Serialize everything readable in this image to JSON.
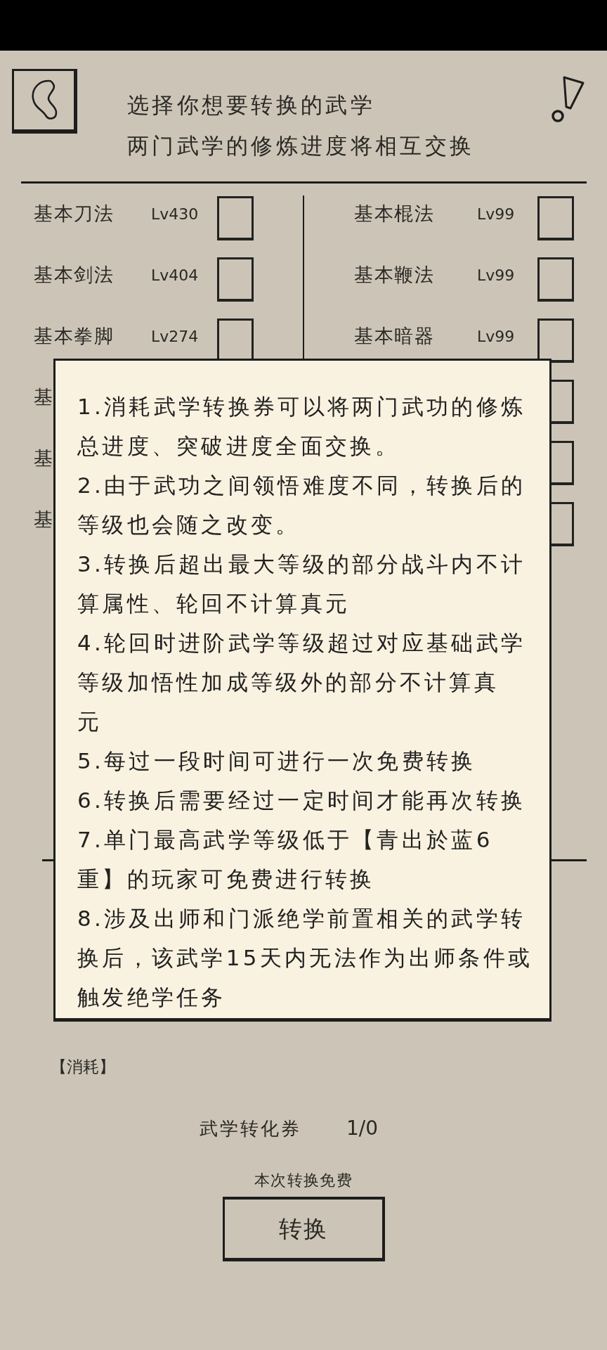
{
  "header": {
    "lines": [
      "选择你想要转换的武学",
      "两门武学的修炼进度将相互交换"
    ]
  },
  "skills": {
    "left": [
      {
        "name": "基本刀法",
        "grade": "Lv430",
        "checked": false
      },
      {
        "name": "基本剑法",
        "grade": "Lv404",
        "checked": false
      },
      {
        "name": "基本拳脚",
        "grade": "Lv274",
        "checked": false
      },
      {
        "name": "基"
      },
      {
        "name": "基"
      },
      {
        "name": "基"
      }
    ],
    "right": [
      {
        "name": "基本棍法",
        "grade": "Lv99",
        "checked": false
      },
      {
        "name": "基本鞭法",
        "grade": "Lv99",
        "checked": false
      },
      {
        "name": "基本暗器",
        "grade": "Lv99",
        "checked": false
      },
      {
        "checked": false
      },
      {
        "checked": false
      },
      {
        "checked": false
      }
    ]
  },
  "info_popup": {
    "notes": [
      {
        "lines": [
          "1.消耗武学转换券可以将两门武功的修炼",
          "总进度、突破进度全面交换。"
        ]
      },
      {
        "lines": [
          "2.由于武功之间领悟难度不同，转换后的",
          "等级也会随之改变。"
        ]
      },
      {
        "lines": [
          "3.转换后超出最大等级的部分战斗内不计",
          "算属性、轮回不计算真元"
        ]
      },
      {
        "lines": [
          "4.轮回时进阶武学等级超过对应基础武学",
          "等级加悟性加成等级外的部分不计算真",
          "元"
        ]
      },
      {
        "lines": [
          "5.每过一段时间可进行一次免费转换"
        ]
      },
      {
        "lines": [
          "6.转换后需要经过一定时间才能再次转换"
        ]
      },
      {
        "lines": [
          "7.单门最高武学等级低于【青出於蓝6",
          "重】的玩家可免费进行转换"
        ]
      },
      {
        "lines": [
          "8.涉及出师和门派绝学前置相关的武学转",
          "换后，该武学15天内无法作为出师条件或",
          "触发绝学任务"
        ]
      }
    ]
  },
  "cost": {
    "label": "【消耗】",
    "items": [
      {
        "name": "武学转化券",
        "count": "1/0"
      }
    ]
  },
  "free_note": "本次转换免费",
  "convert_button": {
    "label": "转换"
  }
}
